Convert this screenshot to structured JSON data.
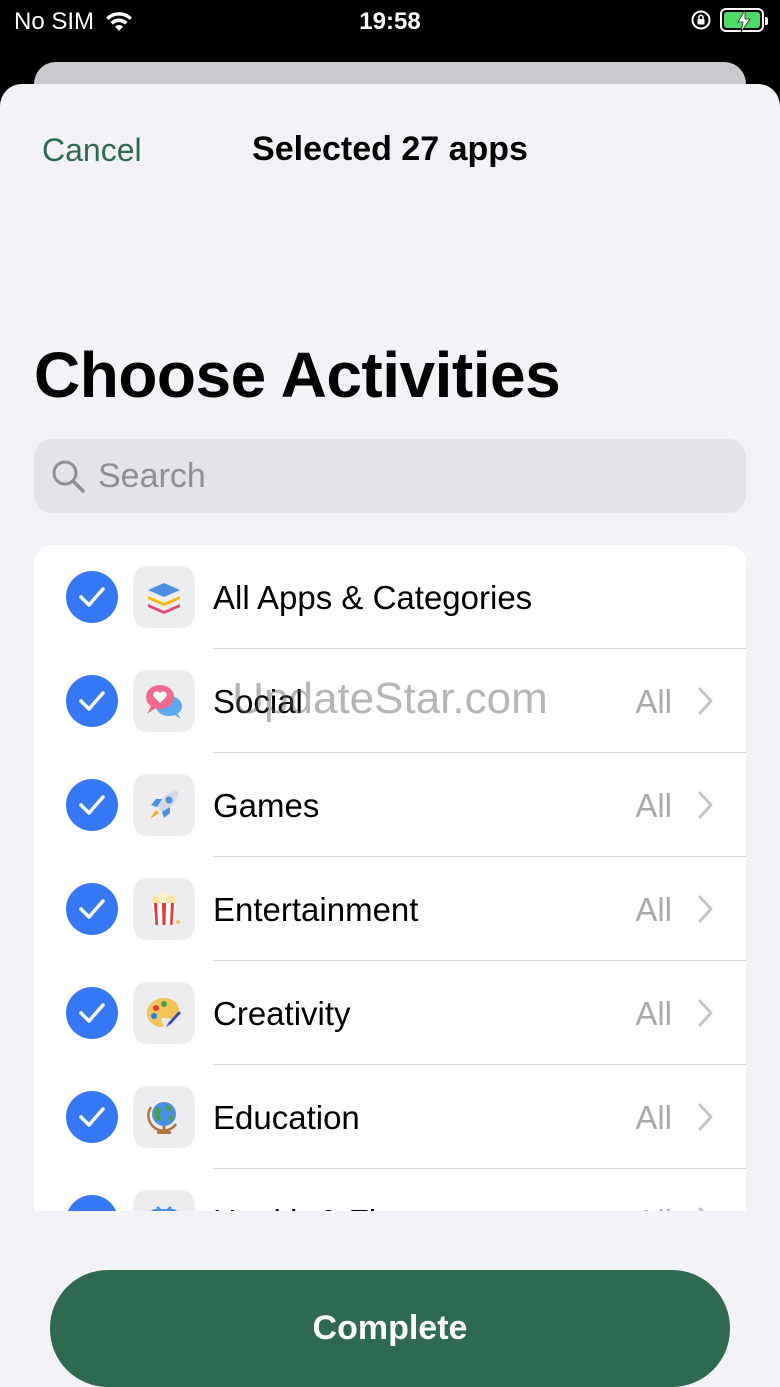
{
  "status_bar": {
    "carrier": "No SIM",
    "time": "19:58"
  },
  "nav": {
    "cancel_label": "Cancel",
    "title": "Selected 27 apps"
  },
  "page": {
    "title": "Choose Activities"
  },
  "search": {
    "placeholder": "Search"
  },
  "categories": [
    {
      "label": "All Apps & Categories",
      "value": "",
      "icon": "stack-icon",
      "checked": true
    },
    {
      "label": "Social",
      "value": "All",
      "icon": "chat-bubbles-icon",
      "checked": true
    },
    {
      "label": "Games",
      "value": "All",
      "icon": "rocket-icon",
      "checked": true
    },
    {
      "label": "Entertainment",
      "value": "All",
      "icon": "popcorn-icon",
      "checked": true
    },
    {
      "label": "Creativity",
      "value": "All",
      "icon": "palette-icon",
      "checked": true
    },
    {
      "label": "Education",
      "value": "All",
      "icon": "globe-icon",
      "checked": true
    },
    {
      "label": "Health & Fitness",
      "value": "All",
      "icon": "scale-icon",
      "checked": true
    }
  ],
  "watermark": "UpdateStar.com",
  "footer": {
    "complete_label": "Complete"
  },
  "colors": {
    "accent_green": "#2e6a4f",
    "check_blue": "#3478f6",
    "background": "#f2f2f7"
  }
}
